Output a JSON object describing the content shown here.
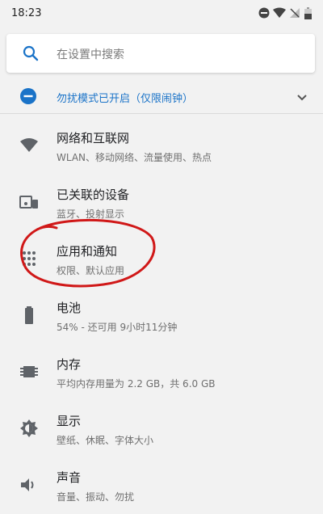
{
  "status_bar": {
    "time": "18:23",
    "icons": [
      "dnd-minus-icon",
      "wifi-icon",
      "signal-off-icon",
      "battery-icon"
    ]
  },
  "search": {
    "placeholder": "在设置中搜索"
  },
  "dnd_banner": {
    "text": "勿扰模式已开启（仅限闹钟）"
  },
  "menu": {
    "items": [
      {
        "icon": "wifi-icon",
        "title": "网络和互联网",
        "subtitle": "WLAN、移动网络、流量使用、热点"
      },
      {
        "icon": "devices-icon",
        "title": "已关联的设备",
        "subtitle": "蓝牙、投射显示"
      },
      {
        "icon": "apps-grid-icon",
        "title": "应用和通知",
        "subtitle": "权限、默认应用"
      },
      {
        "icon": "battery-icon",
        "title": "电池",
        "subtitle": "54% - 还可用 9小时11分钟"
      },
      {
        "icon": "memory-icon",
        "title": "内存",
        "subtitle": "平均内存用量为 2.2 GB，共 6.0 GB"
      },
      {
        "icon": "brightness-icon",
        "title": "显示",
        "subtitle": "壁纸、休眠、字体大小"
      },
      {
        "icon": "volume-icon",
        "title": "声音",
        "subtitle": "音量、振动、勿扰"
      }
    ]
  },
  "colors": {
    "accent": "#1a73c8",
    "icon_gray": "#5f6368",
    "annotation": "#d01818"
  }
}
